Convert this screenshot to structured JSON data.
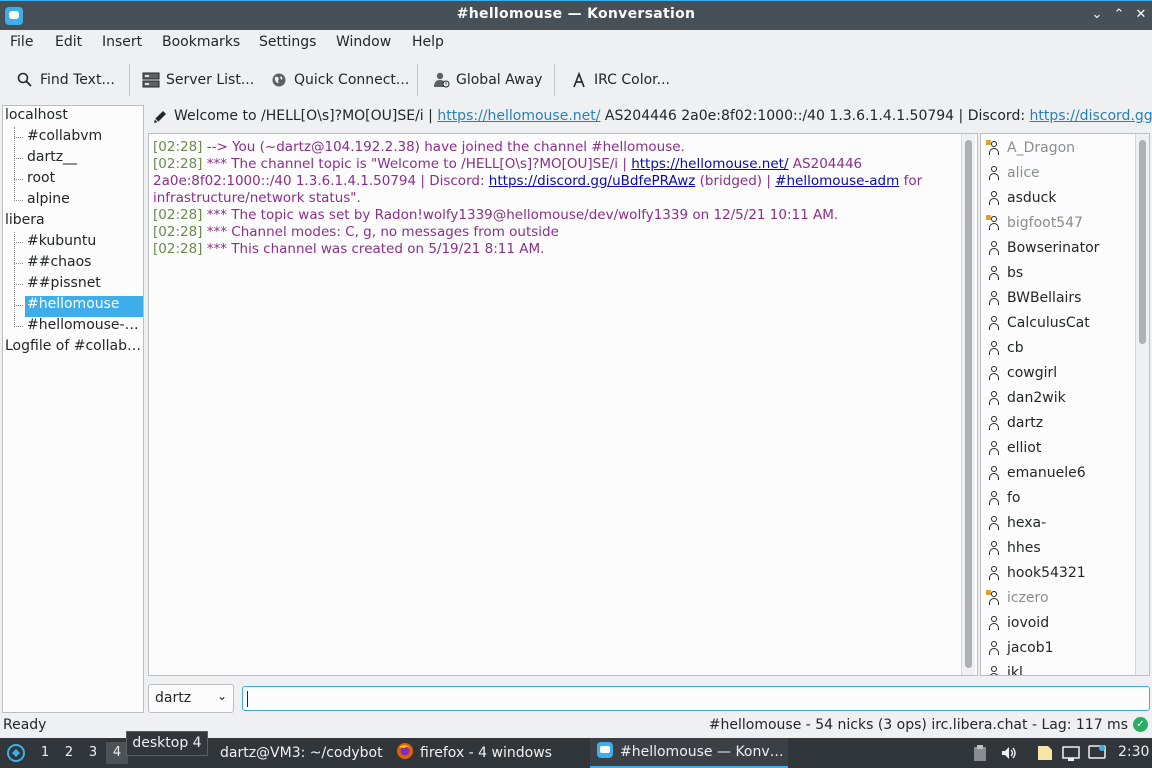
{
  "window": {
    "title": "#hellomouse — Konversation"
  },
  "menu": [
    "File",
    "Edit",
    "Insert",
    "Bookmarks",
    "Settings",
    "Window",
    "Help"
  ],
  "toolbar": {
    "find": "Find Text...",
    "server_list": "Server List...",
    "quick_connect": "Quick Connect...",
    "global_away": "Global Away",
    "irc_color": "IRC Color..."
  },
  "tree": {
    "localhost": "localhost",
    "localhost_children": [
      "#collabvm",
      "dartz__",
      "root",
      "alpine"
    ],
    "libera": "libera",
    "libera_children": [
      "#kubuntu",
      "##chaos",
      "##pissnet",
      "#hellomouse",
      "#hellomouse-…"
    ],
    "logfile": "Logfile of #collab…"
  },
  "topic": {
    "prefix": "Welcome to /HELL[O\\s]?MO[OU]SE/i | ",
    "link1": "https://hellomouse.net/",
    "middle": " AS204446 2a0e:8f02:1000::/40 1.3.6.1.4.1.50794 | Discord: ",
    "link2": "https://discord.gg/…"
  },
  "chat": {
    "join": {
      "ts": "[02:28]",
      "text": " --> You (~dartz@104.192.2.38) have joined the channel #hellomouse."
    },
    "topic_line": {
      "ts": "[02:28]",
      "a": " *** The channel topic is \"Welcome to /HELL[O\\s]?MO[OU]SE/i | ",
      "link1": "https://hellomouse.net/",
      "b": " AS204446 2a0e:8f02:1000::/40 1.3.6.1.4.1.50794 | Discord: ",
      "link2": "https://discord.gg/uBdfePRAwz",
      "c": " (bridged) | ",
      "link3": "#hellomouse-adm",
      "d": " for infrastructure/network status\"."
    },
    "set_by": {
      "ts": "[02:28]",
      "text": " *** The topic was set by Radon!wolfy1339@hellomouse/dev/wolfy1339 on 12/5/21 10:11 AM."
    },
    "modes": {
      "ts": "[02:28]",
      "text": " *** Channel modes: C, g, no messages from outside"
    },
    "created": {
      "ts": "[02:28]",
      "text": " *** This channel was created on 5/19/21 8:11 AM."
    }
  },
  "nicks": [
    {
      "name": "A_Dragon",
      "op": true,
      "away": true
    },
    {
      "name": "alice",
      "op": false,
      "away": true
    },
    {
      "name": "asduck",
      "op": false,
      "away": false
    },
    {
      "name": "bigfoot547",
      "op": true,
      "away": true
    },
    {
      "name": "Bowserinator",
      "op": false,
      "away": false
    },
    {
      "name": "bs",
      "op": false,
      "away": false
    },
    {
      "name": "BWBellairs",
      "op": false,
      "away": false
    },
    {
      "name": "CalculusCat",
      "op": false,
      "away": false
    },
    {
      "name": "cb",
      "op": false,
      "away": false
    },
    {
      "name": "cowgirl",
      "op": false,
      "away": false
    },
    {
      "name": "dan2wik",
      "op": false,
      "away": false
    },
    {
      "name": "dartz",
      "op": false,
      "away": false
    },
    {
      "name": "elliot",
      "op": false,
      "away": false
    },
    {
      "name": "emanuele6",
      "op": false,
      "away": false
    },
    {
      "name": "fo",
      "op": false,
      "away": false
    },
    {
      "name": "hexa-",
      "op": false,
      "away": false
    },
    {
      "name": "hhes",
      "op": false,
      "away": false
    },
    {
      "name": "hook54321",
      "op": false,
      "away": false
    },
    {
      "name": "iczero",
      "op": true,
      "away": true
    },
    {
      "name": "iovoid",
      "op": false,
      "away": false
    },
    {
      "name": "jacob1",
      "op": false,
      "away": false
    },
    {
      "name": "jkl",
      "op": false,
      "away": false
    }
  ],
  "input": {
    "nick": "dartz"
  },
  "status": {
    "left": "Ready",
    "right": "#hellomouse - 54 nicks (3 ops)  irc.libera.chat - Lag: 117 ms"
  },
  "taskbar": {
    "desktops": [
      "1",
      "2",
      "3",
      "4"
    ],
    "tooltip": "desktop 4",
    "terminal": "dartz@VM3: ~/codybot",
    "firefox": "firefox - 4 windows",
    "konversation": "#hellomouse — Konv…",
    "clock": "2:30"
  },
  "colors": {
    "accent": "#3daee9",
    "chat_text": "#8b2f8b",
    "timestamp": "#6b8b4b"
  }
}
